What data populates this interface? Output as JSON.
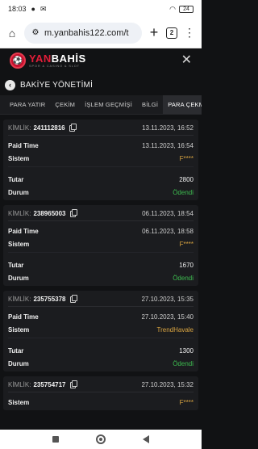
{
  "status_bar": {
    "time": "18:03",
    "battery": "24"
  },
  "browser": {
    "url": "m.yanbahis122.com/t",
    "tabs_count": "2"
  },
  "site": {
    "logo_name_part1": "YAN",
    "logo_name_part2": "BAHİS",
    "logo_tagline": "SPOR & CASINO & SLOT"
  },
  "section": {
    "title": "BAKİYE YÖNETİMİ"
  },
  "tabs": [
    {
      "label": "PARA YATIR"
    },
    {
      "label": "ÇEKİM"
    },
    {
      "label": "İŞLEM GEÇMİŞİ"
    },
    {
      "label": "BİLGİ"
    },
    {
      "label": "PARA ÇEKME DUR"
    }
  ],
  "labels": {
    "kimlik": "KİMLİK:",
    "paid_time": "Paid Time",
    "sistem": "Sistem",
    "tutar": "Tutar",
    "durum": "Durum"
  },
  "transactions": [
    {
      "id": "241112816",
      "date": "13.11.2023, 16:52",
      "paid_time": "13.11.2023, 16:54",
      "system": "F****",
      "amount": "2800",
      "status": "Ödendi"
    },
    {
      "id": "238965003",
      "date": "06.11.2023, 18:54",
      "paid_time": "06.11.2023, 18:58",
      "system": "F****",
      "amount": "1670",
      "status": "Ödendi"
    },
    {
      "id": "235755378",
      "date": "27.10.2023, 15:35",
      "paid_time": "27.10.2023, 15:40",
      "system": "TrendHavale",
      "amount": "1300",
      "status": "Ödendi"
    },
    {
      "id": "235754717",
      "date": "27.10.2023, 15:32",
      "system": "F****"
    }
  ],
  "colors": {
    "brand_red": "#e21d38",
    "status_green": "#3dbb4f",
    "system_gold": "#d9a441"
  }
}
